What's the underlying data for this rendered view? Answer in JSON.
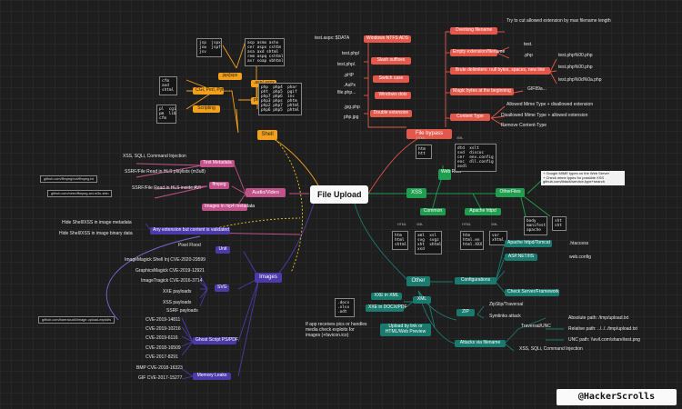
{
  "root": {
    "title": "File Upload"
  },
  "branches": {
    "file_bypass": "File bypass",
    "xss": "XSS",
    "other": "Other",
    "audio_video": "Audio/Video",
    "images": "Images",
    "shell": "Shell",
    "web_root": "Web Root",
    "otherfiles": "OtherFiles",
    "common": "Common",
    "apache_httpd": "Apache httpd",
    "xxe_in_xml": "XXE in XML",
    "xxe_docx": "XXE in DOCX/PDF",
    "xml": "XML",
    "zip": "ZIP",
    "upload_link": "Upload by link or HTML/Web Preview",
    "configurations": "Configurations",
    "attacks_filename": "Attacks via filename"
  },
  "bypass": {
    "windows_ntfs": "Windows NTFS ADS",
    "slash_suffixes": "Slash suffixes",
    "switch_case": "Switch case",
    "windows_dots": "Windows dots",
    "double_extension": "Double extension",
    "overlong": "Overlong filename",
    "empty_ext": "Empty extension/filename",
    "brute_delim": "Brute delimiters: null bytes, spaces, new line",
    "magic_bytes": "Magic bytes at the beginning",
    "content_type": "Content Type",
    "ads": "test.aspx::$DATA",
    "slash": "test.php/",
    "slashdot": "test.php/.",
    "php": ".pHP",
    "asp": ".AsPx",
    "dots": "file.php...",
    "jpgphp": ".jpg.php",
    "phpjpg": "php.jpg",
    "overlong_note": "Try to cut allowed extension by max filename length",
    "empty_a": "test.",
    "empty_b": ".php",
    "gif89": "GIF89a...",
    "null_a": "test.php%00.php",
    "null_b": "test.php%00.php",
    "null_c": "test.php%0d%0a.php",
    "ct_a": "Allowed Mime Type + disallowed extension",
    "ct_b": "Disallowed Mime Type + allowed extension",
    "ct_c": "Remove Content-Type"
  },
  "shell": {
    "php_ext": "php5/7/8",
    "asp_ext": ".asp/.aspx",
    "jsp_ext": "jsp/jspx",
    "cgi_ext": "CGI, Perl, Python",
    "scripting": "Scripting",
    "perl": "pl  cgi\npm  lib\ncfm",
    "cfm": "cfm\naxd\nshtml",
    "jsp": "jsp  jspx\njsw  jspf\njsv",
    "asp": "asp asmx ashx\ncer aspx cshtm\nasa axd shtml\nrem aspq cshtml\nasr soap vbhtml",
    "php": "php  php4  phar\npht  php5  pgif\nphp7 php6  inc\nphp3 phps  phtm\nphp2 php7  phtml\nphp6 php5  phtml"
  },
  "otherfiles": {
    "htaccess_box": "htm\nhtt",
    "configs": "dtd  xslt\nsvd  discoc\ncer  env.config\nenc  dll.config\nasdl",
    "common": "htm\nhtml\nshtml",
    "apache": "htm\nhtml.en\nhtml.XXX",
    "apache2": "var\nxhtml",
    "body": "body\nmanifest\napache",
    "misc": "sht\nsht",
    "notes": "+ Google MIME types on the Web Server\n+ Check mime types for possible XSS\ngithub.com/iblack/service-type+search",
    "xml": "xml  xsl\nsvg  svgz\nxht  xhtml\nxsd",
    "cap_html": "HTML",
    "cap_xml": "XML",
    "cap_common": "HTML",
    "cap_apache": "XML",
    "cap_misc": "XML"
  },
  "other": {
    "apache_cfg": "Apache httpd/Tomcat",
    "aspnet": "ASP.NET/IIS",
    "check_framework": "Check Server/Framework",
    "htaccess": ".htaccess",
    "webconfig": "web.config",
    "zipslip": "ZipSlip/Traversal",
    "symlinks": "Symlinks attack",
    "traversal": "Traversal/UNC",
    "abs_path": "Absolute path: /tmp/upload.txt",
    "rel_path": "Relative path: ../../../tmp/upload.txt",
    "unc_path": "UNC path: \\\\evil.com\\share\\test.png",
    "xss_sqli": "XSS, SQLi, Command Injection",
    "docx": ".docx\n.xlsx\n.odt",
    "link_note": "If app receives pics or handles\nmedia check exploits for\nimages (+favicon.ico)"
  },
  "av": {
    "text_metadata": "Text Metadata",
    "ffmpeg": "ffmpeg",
    "mp4_meta": "Images in mp4 metadata",
    "xss_sqli": "XSS, SQLi, Command Injection",
    "ssrf_hls": "SSRF/File Read in HLS playlists (m3u8)",
    "ssrf_avi": "SSRF/File Read in HLS inside AVI",
    "link1": "github.com/ffmpeg/not/ffmpeg.txt",
    "link2": "github.com/neex/ffmpeg-avi-m3u-xbin",
    "hide_meta": "Hide Shell/XSS in image metadata",
    "hide_binary": "Hide Shell/XSS in image binary data",
    "validated": "Any extension but content is validated"
  },
  "images": {
    "pixel_flood": "Pixel Flood",
    "unit": "Unit",
    "svg": "SVG",
    "ghostscript": "Ghost Script PS/PDF",
    "memory": "Memory Leaks",
    "cve_magick": "ImageMagick Shell Inj CVE-2020-29599",
    "cve_gm": "GraphicsMagick CVE-2019-12921",
    "cve_it": "ImageTragick CVE-2016-3714",
    "xxe_payloads": "XXE payloads",
    "xss_payloads": "XSS payloads",
    "ssrf_payloads": "SSRF payloads",
    "gs1": "CVE-2019-14811",
    "gs2": "CVE-2019-10216",
    "gs3": "CVE-2019-6116",
    "gs4": "CVE-2018-16509",
    "gs5": "CVE-2017-8291",
    "mem1": "BMP CVE-2018-16323",
    "mem2": "GIF CVE-2017-15277",
    "exploits_link": "github.com/barrracud4/image-upload-exploits"
  },
  "footer": "@HackerScrolls"
}
